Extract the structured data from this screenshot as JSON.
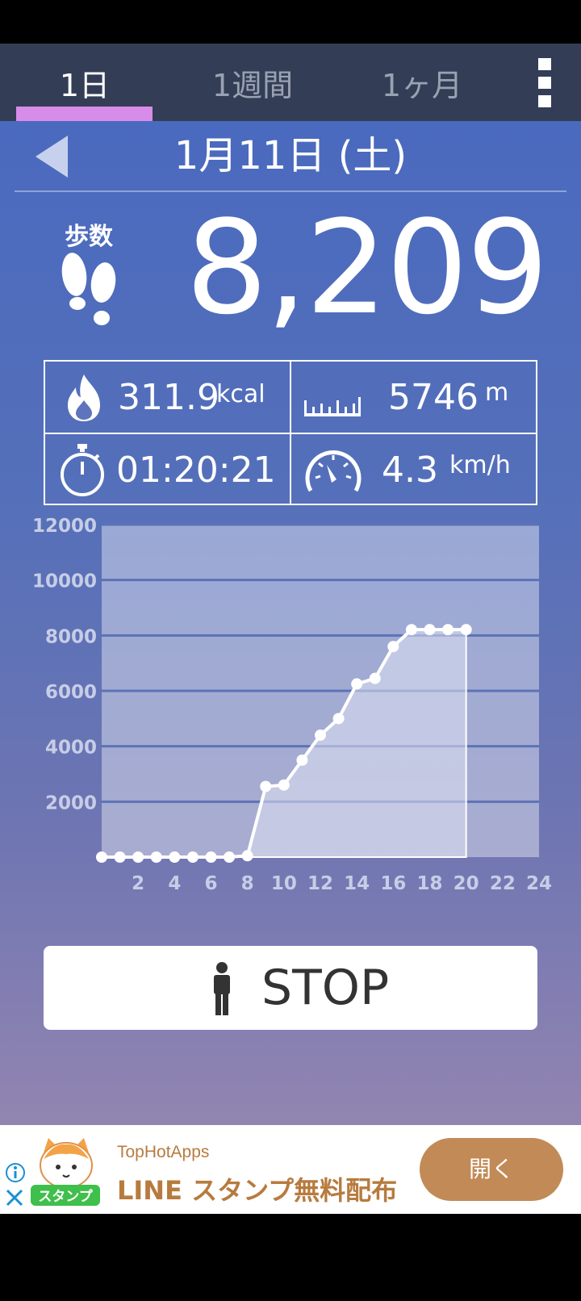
{
  "tabs": [
    {
      "label": "1日",
      "active": true
    },
    {
      "label": "1週間",
      "active": false
    },
    {
      "label": "1ヶ月",
      "active": false
    }
  ],
  "header": {
    "date": "1月11日 (土)"
  },
  "steps": {
    "label": "歩数",
    "value": "8,209"
  },
  "stats": {
    "calories": {
      "value": "311.9",
      "unit": "kcal"
    },
    "distance": {
      "value": "5746",
      "unit": "m"
    },
    "time": {
      "value": "01:20:21"
    },
    "speed": {
      "value": "4.3",
      "unit": "km/h"
    }
  },
  "chart_data": {
    "type": "area",
    "x": [
      0,
      1,
      2,
      3,
      4,
      5,
      6,
      7,
      8,
      9,
      10,
      11,
      12,
      13,
      14,
      15,
      16,
      17,
      18,
      19,
      20
    ],
    "values": [
      0,
      0,
      0,
      0,
      0,
      0,
      0,
      0,
      50,
      2550,
      2600,
      3500,
      4400,
      5000,
      6250,
      6450,
      7600,
      8209,
      8209,
      8209,
      8209
    ],
    "x_ticks": [
      "2",
      "4",
      "6",
      "8",
      "10",
      "12",
      "14",
      "16",
      "18",
      "20",
      "22",
      "24"
    ],
    "y_ticks": [
      "2000",
      "4000",
      "6000",
      "8000",
      "10000",
      "12000"
    ],
    "xlim": [
      0,
      24
    ],
    "ylim": [
      0,
      12000
    ],
    "grid": true
  },
  "stop_button": {
    "label": "STOP"
  },
  "ad": {
    "advertiser": "TopHotApps",
    "headline": "LINE スタンプ無料配布",
    "cta": "開く",
    "image_text": "スタンプ"
  },
  "colors": {
    "tab_bar": "#333d55",
    "tab_indicator": "#d68ce8",
    "ad_button": "#c28a56"
  }
}
